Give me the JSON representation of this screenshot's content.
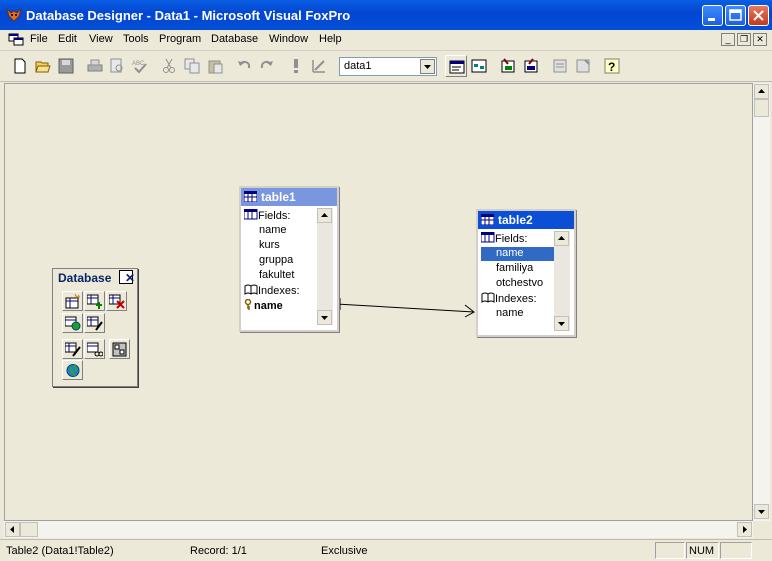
{
  "window": {
    "title": "Database Designer - Data1 - Microsoft Visual FoxPro"
  },
  "menu": {
    "items": [
      "File",
      "Edit",
      "View",
      "Tools",
      "Program",
      "Database",
      "Window",
      "Help"
    ]
  },
  "toolbar": {
    "database_combo_value": "data1"
  },
  "tables": [
    {
      "name": "table1",
      "fields_label": "Fields:",
      "fields": [
        "name",
        "kurs",
        "gruppa",
        "fakultet"
      ],
      "indexes_label": "Indexes:",
      "indexes": [
        "name"
      ],
      "active": false
    },
    {
      "name": "table2",
      "fields_label": "Fields:",
      "fields": [
        "name",
        "familiya",
        "otchestvo"
      ],
      "indexes_label": "Indexes:",
      "indexes": [
        "name"
      ],
      "active": true,
      "selected_field": "name"
    }
  ],
  "database_toolbar": {
    "title": "Database"
  },
  "status": {
    "left": "Table2 (Data1!Table2)",
    "record": "Record: 1/1",
    "mode": "Exclusive",
    "num": "NUM"
  },
  "colors": {
    "titlebar": "#0a5fe4",
    "active_header": "#0b4fd6",
    "inactive_header": "#7a96df",
    "selection": "#316ac5",
    "workspace": "#ece9d8"
  }
}
